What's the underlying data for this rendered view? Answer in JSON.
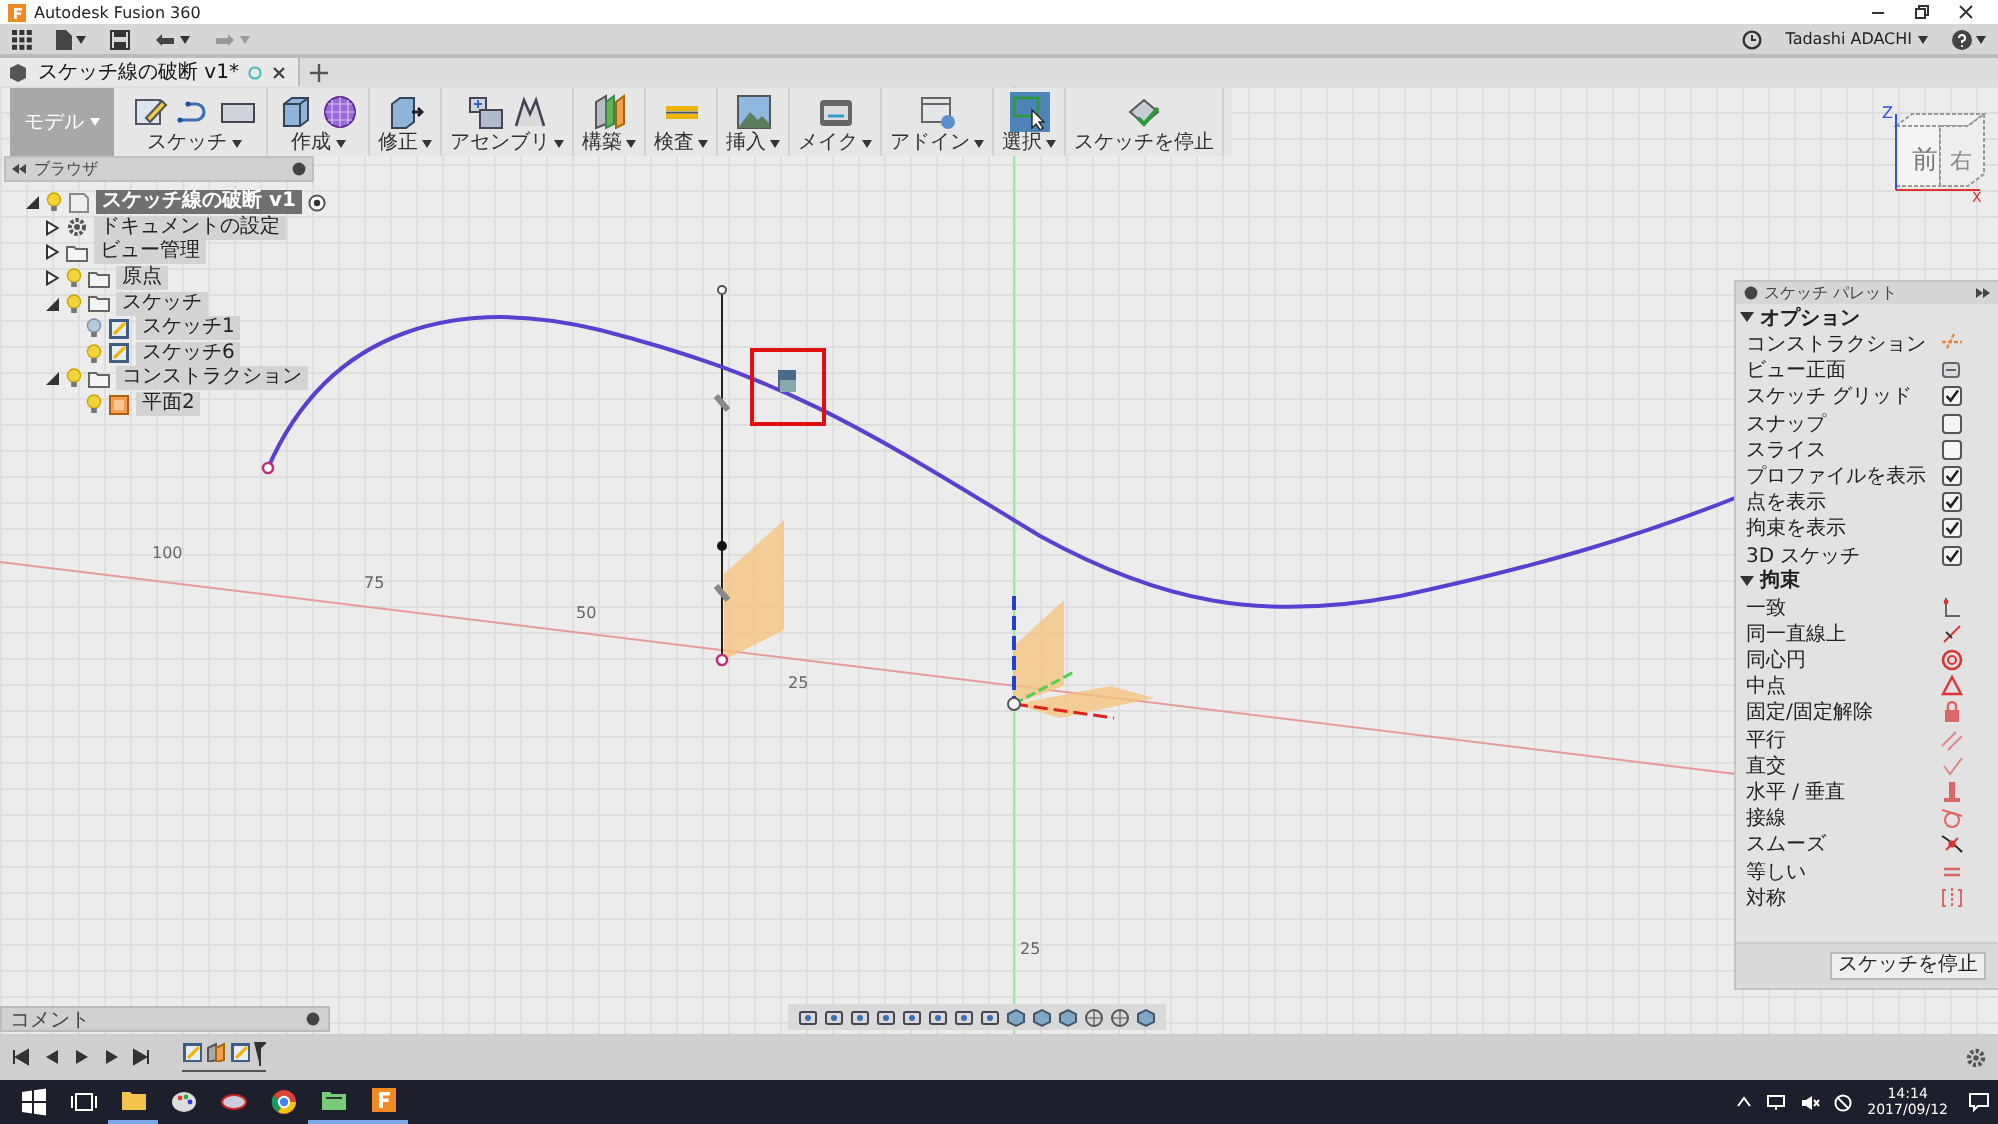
{
  "window": {
    "title": "Autodesk Fusion 360"
  },
  "user": {
    "name": "Tadashi ADACHI"
  },
  "tabs": [
    {
      "label": "スケッチ線の破断 v1*",
      "selected": true
    }
  ],
  "toolbar": {
    "workspace": "モデル",
    "groups": [
      {
        "label": "スケッチ",
        "selected": false,
        "dropdown": true
      },
      {
        "label": "作成",
        "selected": false,
        "dropdown": true
      },
      {
        "label": "修正",
        "selected": false,
        "dropdown": true
      },
      {
        "label": "アセンブリ",
        "selected": false,
        "dropdown": true
      },
      {
        "label": "構築",
        "selected": false,
        "dropdown": true
      },
      {
        "label": "検査",
        "selected": false,
        "dropdown": true
      },
      {
        "label": "挿入",
        "selected": false,
        "dropdown": true
      },
      {
        "label": "メイク",
        "selected": false,
        "dropdown": true
      },
      {
        "label": "アドイン",
        "selected": false,
        "dropdown": true
      },
      {
        "label": "選択",
        "selected": true,
        "dropdown": true
      },
      {
        "label": "スケッチを停止",
        "selected": false,
        "dropdown": false
      }
    ]
  },
  "browser": {
    "title": "ブラウザ",
    "items": [
      {
        "label": "スケッチ線の破断 v1",
        "kind": "component",
        "selected": true,
        "expanded": true,
        "visible": true,
        "children": [
          {
            "label": "ドキュメントの設定",
            "kind": "settings",
            "selected": false,
            "expanded": false
          },
          {
            "label": "ビュー管理",
            "kind": "folder",
            "selected": false,
            "expanded": false
          },
          {
            "label": "原点",
            "kind": "folder",
            "selected": false,
            "expanded": false,
            "visible": true
          },
          {
            "label": "スケッチ",
            "kind": "folder",
            "selected": false,
            "expanded": true,
            "visible": true,
            "children": [
              {
                "label": "スケッチ1",
                "kind": "sketch",
                "selected": false,
                "visible": false
              },
              {
                "label": "スケッチ6",
                "kind": "sketch",
                "selected": false,
                "visible": true
              }
            ]
          },
          {
            "label": "コンストラクション",
            "kind": "folder",
            "selected": false,
            "expanded": true,
            "visible": true,
            "children": [
              {
                "label": "平面2",
                "kind": "plane",
                "selected": false,
                "visible": true
              }
            ]
          }
        ]
      }
    ]
  },
  "palette": {
    "title": "スケッチ パレット",
    "sections": [
      {
        "title": "オプション",
        "expanded": true,
        "rows": [
          {
            "label": "コンストラクション",
            "kind": "icon"
          },
          {
            "label": "ビュー正面",
            "kind": "icon"
          },
          {
            "label": "スケッチ グリッド",
            "kind": "checkbox",
            "checked": true
          },
          {
            "label": "スナップ",
            "kind": "checkbox",
            "checked": false
          },
          {
            "label": "スライス",
            "kind": "checkbox",
            "checked": false
          },
          {
            "label": "プロファイルを表示",
            "kind": "checkbox",
            "checked": true
          },
          {
            "label": "点を表示",
            "kind": "checkbox",
            "checked": true
          },
          {
            "label": "拘束を表示",
            "kind": "checkbox",
            "checked": true
          },
          {
            "label": "3D スケッチ",
            "kind": "checkbox",
            "checked": true
          }
        ]
      },
      {
        "title": "拘束",
        "expanded": true,
        "rows": [
          {
            "label": "一致",
            "kind": "icon"
          },
          {
            "label": "同一直線上",
            "kind": "icon"
          },
          {
            "label": "同心円",
            "kind": "icon"
          },
          {
            "label": "中点",
            "kind": "icon"
          },
          {
            "label": "固定/固定解除",
            "kind": "icon"
          },
          {
            "label": "平行",
            "kind": "icon"
          },
          {
            "label": "直交",
            "kind": "icon"
          },
          {
            "label": "水平 / 垂直",
            "kind": "icon"
          },
          {
            "label": "接線",
            "kind": "icon"
          },
          {
            "label": "スムーズ",
            "kind": "icon"
          },
          {
            "label": "等しい",
            "kind": "icon"
          },
          {
            "label": "対称",
            "kind": "icon"
          }
        ]
      }
    ],
    "button": "スケッチを停止"
  },
  "comments": {
    "title": "コメント"
  },
  "viewcube": {
    "front": "前",
    "right": "右",
    "axis_z": "Z",
    "axis_x": "X"
  },
  "canvas": {
    "ruler_labels": [
      "100",
      "75",
      "50",
      "25"
    ],
    "vertical_label": "25"
  },
  "taskbar": {
    "time": "14:14",
    "date": "2017/09/12"
  }
}
